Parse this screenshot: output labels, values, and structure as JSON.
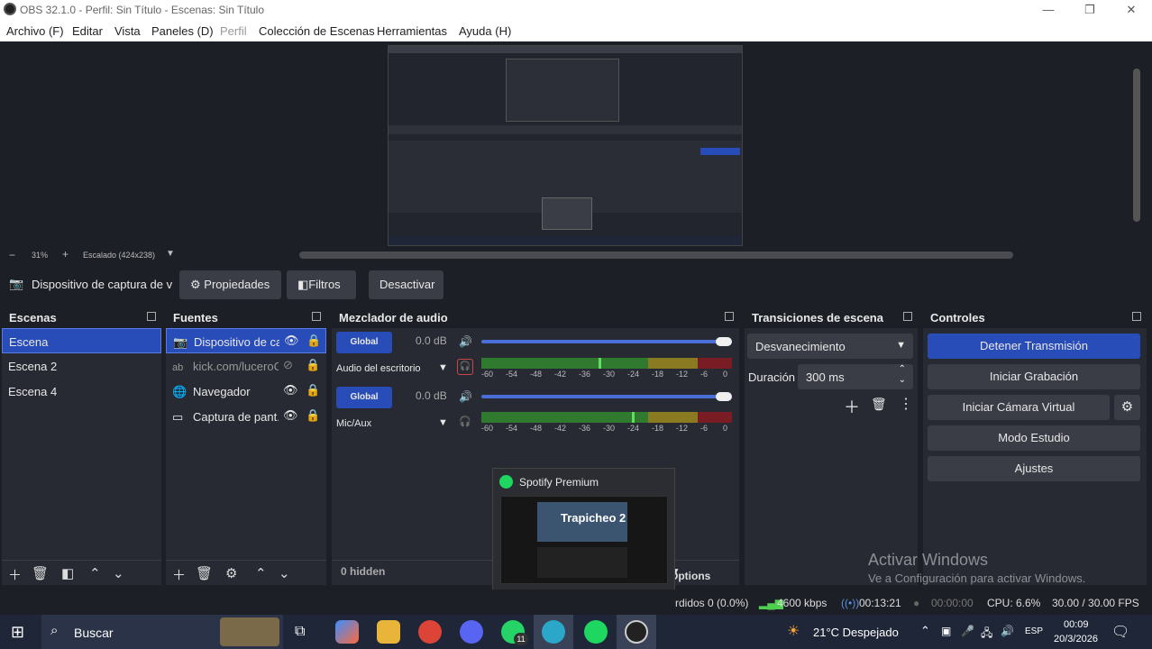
{
  "window": {
    "title": "OBS 32.1.0 - Perfil: Sin Título - Escenas: Sin Título"
  },
  "menu": [
    "Archivo (F)",
    "Editar",
    "Vista",
    "Paneles (D)",
    "Perfil",
    "Colección de Escenas",
    "Herramientas",
    "Ayuda (H)"
  ],
  "preview": {
    "zoom": "31%",
    "scale": "Escalado (424x238)"
  },
  "source_bar": {
    "selected": "Dispositivo de captura de v",
    "props": "Propiedades",
    "filters": "Filtros",
    "deactivate": "Desactivar"
  },
  "scenes": {
    "title": "Escenas",
    "items": [
      "Escena",
      "Escena 2",
      "Escena 4"
    ]
  },
  "sources": {
    "title": "Fuentes",
    "items": [
      "Dispositivo de ca",
      "kick.com/luceroC",
      "Navegador",
      "Captura de pant."
    ]
  },
  "mixer": {
    "title": "Mezclador de audio",
    "channels": [
      {
        "name": "Audio del escritorio",
        "db": "0.0 dB",
        "global": "Global",
        "level": 0.45
      },
      {
        "name": "Mic/Aux",
        "db": "0.0 dB",
        "global": "Global",
        "level": 0.6
      }
    ],
    "ticks": [
      "-60",
      "-54",
      "-48",
      "-42",
      "-36",
      "-30",
      "-24",
      "-18",
      "-12",
      "-6",
      "0"
    ],
    "hidden": "0 hidden",
    "options": "Options"
  },
  "transitions": {
    "title": "Transiciones de escena",
    "selected": "Desvanecimiento",
    "duration_label": "Duración",
    "duration_value": "300 ms"
  },
  "controls": {
    "title": "Controles",
    "stop_stream": "Detener Transmisión",
    "start_record": "Iniciar Grabación",
    "virtual_cam": "Iniciar Cámara Virtual",
    "studio_mode": "Modo Estudio",
    "settings": "Ajustes"
  },
  "status": {
    "dropped": "rdidos 0 (0.0%)",
    "bitrate": "4600 kbps",
    "stream_time": "00:13:21",
    "rec_time": "00:00:00",
    "cpu": "CPU: 6.6%",
    "fps": "30.00 / 30.00 FPS"
  },
  "watermark": {
    "line1": "Activar Windows",
    "line2": "Ve a Configuración para activar Windows."
  },
  "spotify_popup": {
    "title": "Spotify Premium",
    "track": "Trapicheo 2"
  },
  "taskbar": {
    "search": "Buscar",
    "weather": "21°C  Despejado",
    "lang": "ESP",
    "time": "00:09",
    "date": "20/3/2026",
    "whatsapp_badge": "11"
  },
  "colors": {
    "accent": "#284cb8",
    "panel": "#272a33",
    "bg": "#1d1f26"
  }
}
